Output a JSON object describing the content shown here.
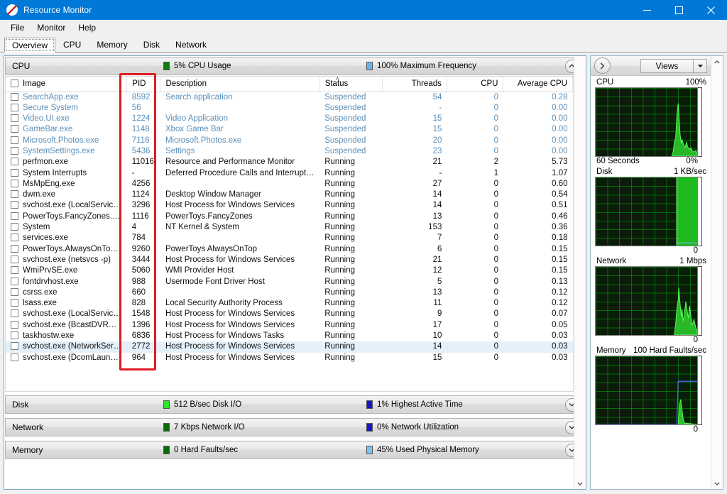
{
  "window": {
    "title": "Resource Monitor",
    "icon": "resource-monitor-icon",
    "minimize": "─",
    "maximize": "□",
    "close": "✕"
  },
  "menu": {
    "items": [
      "File",
      "Monitor",
      "Help"
    ]
  },
  "tabs": {
    "active": "Overview",
    "items": [
      "Overview",
      "CPU",
      "Memory",
      "Disk",
      "Network"
    ]
  },
  "sections": {
    "cpu": {
      "name": "CPU",
      "metric1": "5% CPU Usage",
      "metric1_color": "#107c10",
      "metric2": "100% Maximum Frequency",
      "metric2_color": "#6cb4e4",
      "expanded": true,
      "chevron": "chevron-up-icon"
    },
    "disk": {
      "name": "Disk",
      "metric1": "512 B/sec Disk I/O",
      "metric1_color": "#2ee62e",
      "metric2": "1% Highest Active Time",
      "metric2_color": "#1616c8",
      "expanded": false,
      "chevron": "chevron-down-icon"
    },
    "network": {
      "name": "Network",
      "metric1": "7 Kbps Network I/O",
      "metric1_color": "#0b6b0b",
      "metric2": "0% Network Utilization",
      "metric2_color": "#1616c8",
      "expanded": false,
      "chevron": "chevron-down-icon"
    },
    "memory": {
      "name": "Memory",
      "metric1": "0 Hard Faults/sec",
      "metric1_color": "#0b6b0b",
      "metric2": "45% Used Physical Memory",
      "metric2_color": "#7ec0ee",
      "expanded": false,
      "chevron": "chevron-down-icon"
    }
  },
  "process_table": {
    "sort_column": "Status",
    "sort_indicator": "˄",
    "columns": [
      "Image",
      "PID",
      "Description",
      "Status",
      "Threads",
      "CPU",
      "Average CPU"
    ],
    "rows": [
      {
        "image": "SearchApp.exe",
        "pid": "8592",
        "description": "Search application",
        "status": "Suspended",
        "threads": "54",
        "cpu": "0",
        "avg": "0.28",
        "state": "suspended",
        "selected": false,
        "dim": false
      },
      {
        "image": "Secure System",
        "pid": "56",
        "description": "",
        "status": "Suspended",
        "threads": "-",
        "cpu": "0",
        "avg": "0.00",
        "state": "suspended",
        "selected": false,
        "dim": false
      },
      {
        "image": "Video.UI.exe",
        "pid": "1224",
        "description": "Video Application",
        "status": "Suspended",
        "threads": "15",
        "cpu": "0",
        "avg": "0.00",
        "state": "suspended",
        "selected": false,
        "dim": false
      },
      {
        "image": "GameBar.exe",
        "pid": "1148",
        "description": "Xbox Game Bar",
        "status": "Suspended",
        "threads": "15",
        "cpu": "0",
        "avg": "0.00",
        "state": "suspended",
        "selected": false,
        "dim": false
      },
      {
        "image": "Microsoft.Photos.exe",
        "pid": "7116",
        "description": "Microsoft.Photos.exe",
        "status": "Suspended",
        "threads": "20",
        "cpu": "0",
        "avg": "0.00",
        "state": "suspended",
        "selected": false,
        "dim": false
      },
      {
        "image": "SystemSettings.exe",
        "pid": "5436",
        "description": "Settings",
        "status": "Suspended",
        "threads": "23",
        "cpu": "0",
        "avg": "0.00",
        "state": "suspended",
        "selected": false,
        "dim": false
      },
      {
        "image": "perfmon.exe",
        "pid": "11016",
        "description": "Resource and Performance Monitor",
        "status": "Running",
        "threads": "21",
        "cpu": "2",
        "avg": "5.73",
        "state": "running",
        "selected": false,
        "dim": false
      },
      {
        "image": "System Interrupts",
        "pid": "-",
        "description": "Deferred Procedure Calls and Interrupt Se...",
        "status": "Running",
        "threads": "-",
        "cpu": "1",
        "avg": "1.07",
        "state": "running",
        "selected": false,
        "dim": false
      },
      {
        "image": "MsMpEng.exe",
        "pid": "4256",
        "description": "",
        "status": "Running",
        "threads": "27",
        "cpu": "0",
        "avg": "0.60",
        "state": "running",
        "selected": false,
        "dim": false
      },
      {
        "image": "dwm.exe",
        "pid": "1124",
        "description": "Desktop Window Manager",
        "status": "Running",
        "threads": "14",
        "cpu": "0",
        "avg": "0.54",
        "state": "running",
        "selected": false,
        "dim": false
      },
      {
        "image": "svchost.exe (LocalServiceNo...",
        "pid": "3296",
        "description": "Host Process for Windows Services",
        "status": "Running",
        "threads": "14",
        "cpu": "0",
        "avg": "0.51",
        "state": "running",
        "selected": false,
        "dim": false
      },
      {
        "image": "PowerToys.FancyZones.exe",
        "pid": "1116",
        "description": "PowerToys.FancyZones",
        "status": "Running",
        "threads": "13",
        "cpu": "0",
        "avg": "0.46",
        "state": "running",
        "selected": false,
        "dim": false
      },
      {
        "image": "System",
        "pid": "4",
        "description": "NT Kernel & System",
        "status": "Running",
        "threads": "153",
        "cpu": "0",
        "avg": "0.36",
        "state": "running",
        "selected": false,
        "dim": false
      },
      {
        "image": "services.exe",
        "pid": "784",
        "description": "",
        "status": "Running",
        "threads": "7",
        "cpu": "0",
        "avg": "0.18",
        "state": "running",
        "selected": false,
        "dim": false
      },
      {
        "image": "PowerToys.AlwaysOnTop.exe",
        "pid": "9260",
        "description": "PowerToys AlwaysOnTop",
        "status": "Running",
        "threads": "6",
        "cpu": "0",
        "avg": "0.15",
        "state": "running",
        "selected": false,
        "dim": false
      },
      {
        "image": "svchost.exe (netsvcs -p)",
        "pid": "3444",
        "description": "Host Process for Windows Services",
        "status": "Running",
        "threads": "21",
        "cpu": "0",
        "avg": "0.15",
        "state": "running",
        "selected": false,
        "dim": false
      },
      {
        "image": "WmiPrvSE.exe",
        "pid": "5060",
        "description": "WMI Provider Host",
        "status": "Running",
        "threads": "12",
        "cpu": "0",
        "avg": "0.15",
        "state": "running",
        "selected": false,
        "dim": false
      },
      {
        "image": "fontdrvhost.exe",
        "pid": "988",
        "description": "Usermode Font Driver Host",
        "status": "Running",
        "threads": "5",
        "cpu": "0",
        "avg": "0.13",
        "state": "running",
        "selected": false,
        "dim": false
      },
      {
        "image": "csrss.exe",
        "pid": "660",
        "description": "",
        "status": "Running",
        "threads": "13",
        "cpu": "0",
        "avg": "0.12",
        "state": "running",
        "selected": false,
        "dim": false
      },
      {
        "image": "lsass.exe",
        "pid": "828",
        "description": "Local Security Authority Process",
        "status": "Running",
        "threads": "11",
        "cpu": "0",
        "avg": "0.12",
        "state": "running",
        "selected": false,
        "dim": false
      },
      {
        "image": "svchost.exe (LocalServiceNet...",
        "pid": "1548",
        "description": "Host Process for Windows Services",
        "status": "Running",
        "threads": "9",
        "cpu": "0",
        "avg": "0.07",
        "state": "running",
        "selected": false,
        "dim": false
      },
      {
        "image": "svchost.exe (BcastDVRUserS...",
        "pid": "1396",
        "description": "Host Process for Windows Services",
        "status": "Running",
        "threads": "17",
        "cpu": "0",
        "avg": "0.05",
        "state": "running",
        "selected": false,
        "dim": true
      },
      {
        "image": "taskhostw.exe",
        "pid": "6836",
        "description": "Host Process for Windows Tasks",
        "status": "Running",
        "threads": "10",
        "cpu": "0",
        "avg": "0.03",
        "state": "running",
        "selected": false,
        "dim": false
      },
      {
        "image": "svchost.exe (NetworkService...",
        "pid": "2772",
        "description": "Host Process for Windows Services",
        "status": "Running",
        "threads": "14",
        "cpu": "0",
        "avg": "0.03",
        "state": "running",
        "selected": true,
        "dim": false
      },
      {
        "image": "svchost.exe (DcomLaunch -p)",
        "pid": "964",
        "description": "Host Process for Windows Services",
        "status": "Running",
        "threads": "15",
        "cpu": "0",
        "avg": "0.03",
        "state": "running",
        "selected": false,
        "dim": false
      }
    ]
  },
  "annotation": {
    "highlight_column": "PID",
    "color": "#e01b24"
  },
  "sidebar": {
    "collapse_button": "chevron-right-icon",
    "views_label": "Views",
    "views_arrow": "chevron-down-icon",
    "graphs": [
      {
        "name": "CPU",
        "max_label": "100%",
        "bottom_left": "60 Seconds",
        "bottom_right": "0%"
      },
      {
        "name": "Disk",
        "max_label": "1 KB/sec",
        "bottom_left": "",
        "bottom_right": "0"
      },
      {
        "name": "Network",
        "max_label": "1 Mbps",
        "bottom_left": "",
        "bottom_right": "0"
      },
      {
        "name": "Memory",
        "max_label": "100 Hard Faults/sec",
        "bottom_left": "",
        "bottom_right": "0"
      }
    ]
  }
}
